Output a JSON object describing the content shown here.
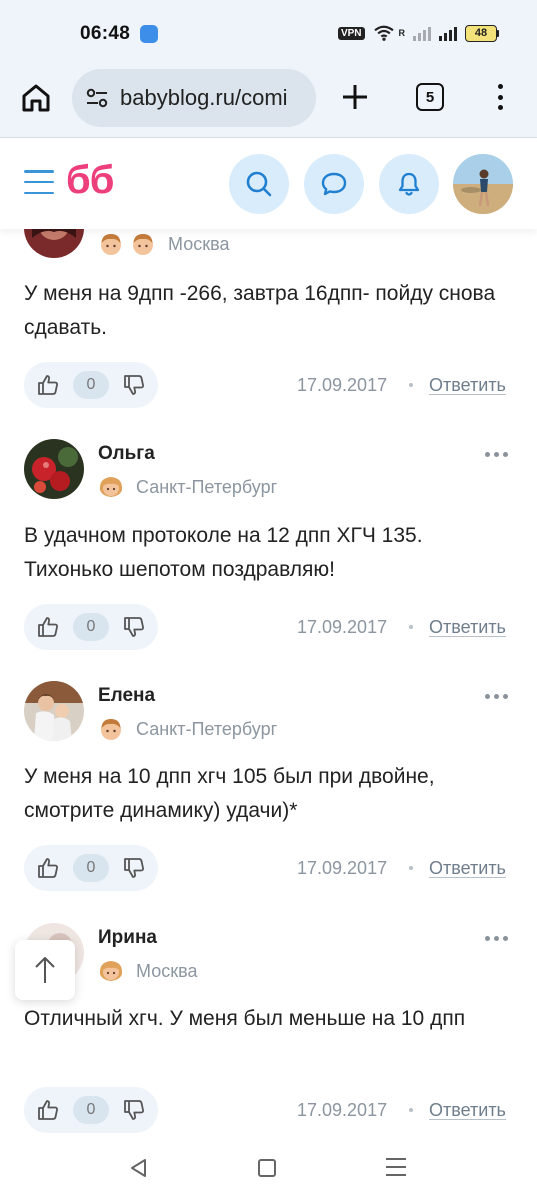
{
  "status_bar": {
    "time": "06:48",
    "vpn": "VPN",
    "signal_r": "R",
    "battery": "48"
  },
  "browser": {
    "url": "babyblog.ru/comi",
    "tab_count": "5"
  },
  "site": {
    "logo": "бб",
    "accent_color": "#ee3f7d",
    "link_color": "#3a94d8"
  },
  "comments": [
    {
      "author": "",
      "city": "Москва",
      "kids": [
        "boy",
        "boy"
      ],
      "text": "У меня на 9дпп -266, завтра 16дпп- пойду снова сдавать.",
      "likes": "0",
      "date": "17.09.2017",
      "reply": "Ответить"
    },
    {
      "author": "Ольга",
      "city": "Санкт-Петербург",
      "kids": [
        "girl"
      ],
      "text": "В удачном протоколе на 12 дпп ХГЧ 135. Тихонько шепотом поздравляю!",
      "likes": "0",
      "date": "17.09.2017",
      "reply": "Ответить"
    },
    {
      "author": "Елена",
      "city": "Санкт-Петербург",
      "kids": [
        "boy"
      ],
      "text": "У меня на 10 дпп хгч 105 был при двойне, смотрите динамику) удачи)*",
      "likes": "0",
      "date": "17.09.2017",
      "reply": "Ответить"
    },
    {
      "author": "Ирина",
      "city": "Москва",
      "kids": [
        "girl"
      ],
      "text": "Отличный хгч. У меня был меньше на 10 дпп",
      "likes": "0",
      "date": "17.09.2017",
      "reply": "Ответить"
    }
  ]
}
